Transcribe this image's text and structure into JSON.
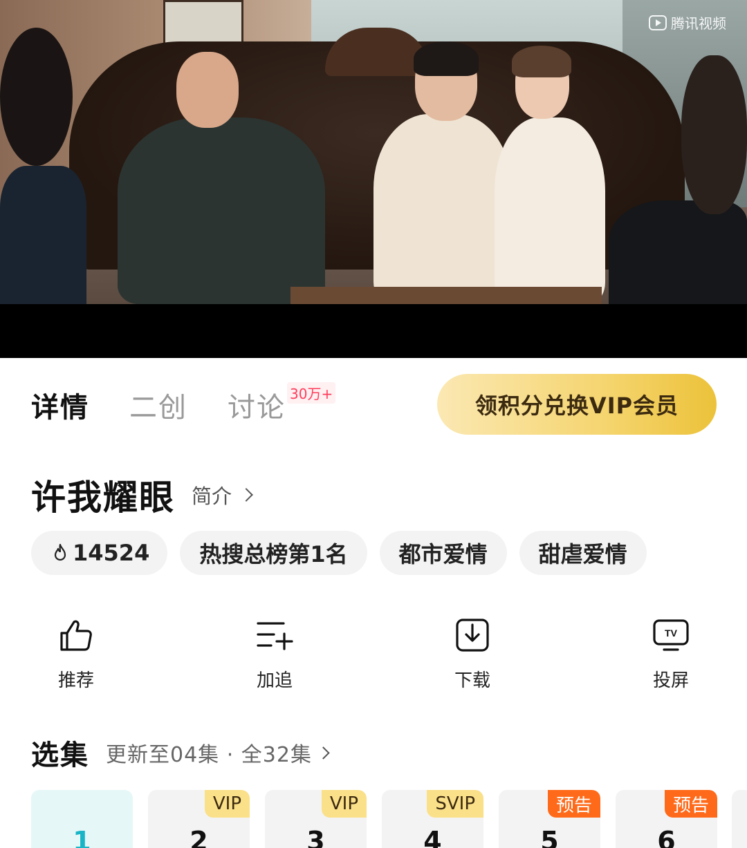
{
  "video": {
    "watermark": "腾讯视频"
  },
  "tabs": [
    {
      "label": "详情",
      "active": true
    },
    {
      "label": "二创",
      "active": false
    },
    {
      "label": "讨论",
      "active": false,
      "badge": "30万+"
    }
  ],
  "vip_button": "领积分兑换VIP会员",
  "show": {
    "title": "许我耀眼",
    "intro_label": "简介"
  },
  "tags": [
    "14524",
    "热搜总榜第1名",
    "都市爱情",
    "甜虐爱情"
  ],
  "actions": [
    {
      "label": "推荐",
      "icon": "thumbs-up-icon"
    },
    {
      "label": "加追",
      "icon": "add-to-list-icon"
    },
    {
      "label": "下载",
      "icon": "download-icon"
    },
    {
      "label": "投屏",
      "icon": "tv-cast-icon"
    }
  ],
  "episodes_header": {
    "title": "选集",
    "subtitle": "更新至04集 · 全32集"
  },
  "episodes": [
    {
      "num": "1",
      "badge": ""
    },
    {
      "num": "2",
      "badge": "VIP"
    },
    {
      "num": "3",
      "badge": "VIP"
    },
    {
      "num": "4",
      "badge": "SVIP"
    },
    {
      "num": "5",
      "badge": "预告"
    },
    {
      "num": "6",
      "badge": "预告"
    }
  ],
  "colors": {
    "accent": "#19b5c6",
    "vip_gold": "#f5d56f",
    "preview_orange": "#ff6a1a",
    "badge_red": "#ff3d5a"
  }
}
